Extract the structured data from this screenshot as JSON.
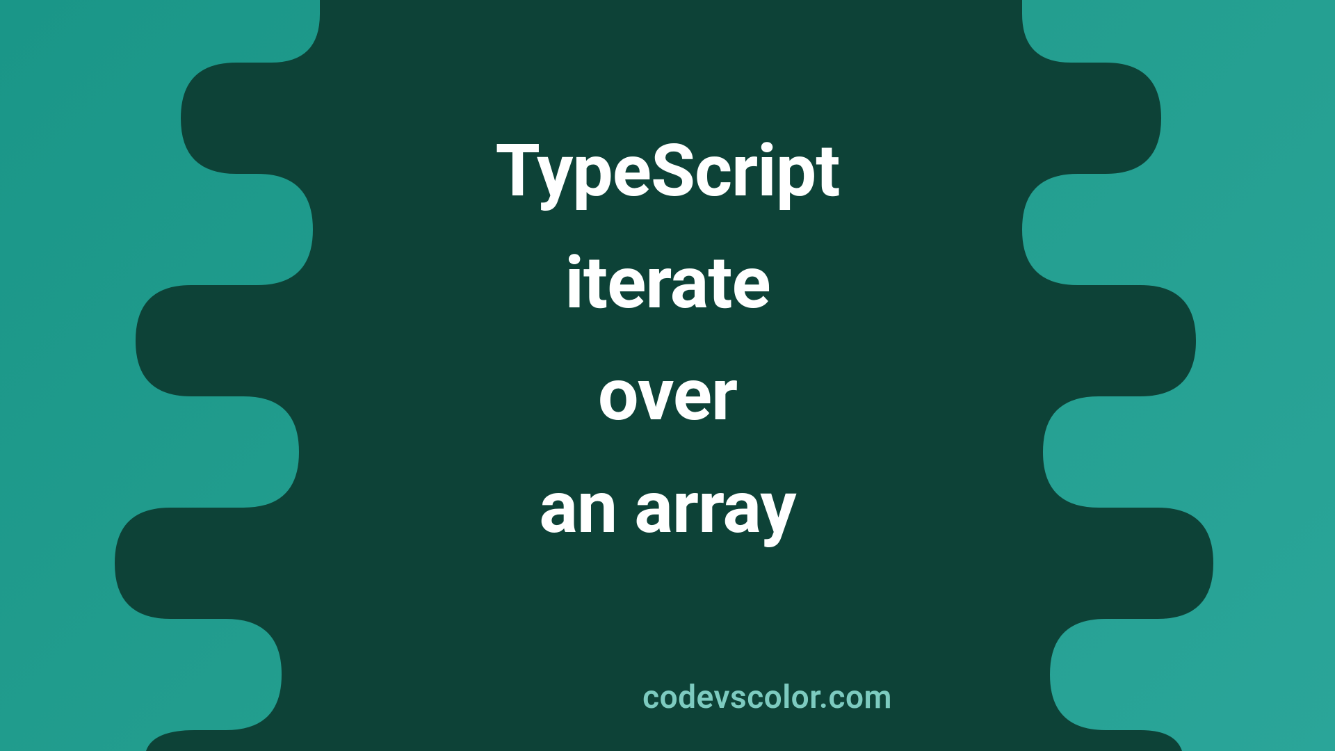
{
  "title": {
    "line1": "TypeScript",
    "line2": "iterate",
    "line3": "over",
    "line4": "an array"
  },
  "credit": "codevscolor.com",
  "colors": {
    "background_start": "#1a9688",
    "background_end": "#2aa599",
    "shape": "#0d4237",
    "text": "#ffffff",
    "credit": "#7dcbc0"
  }
}
